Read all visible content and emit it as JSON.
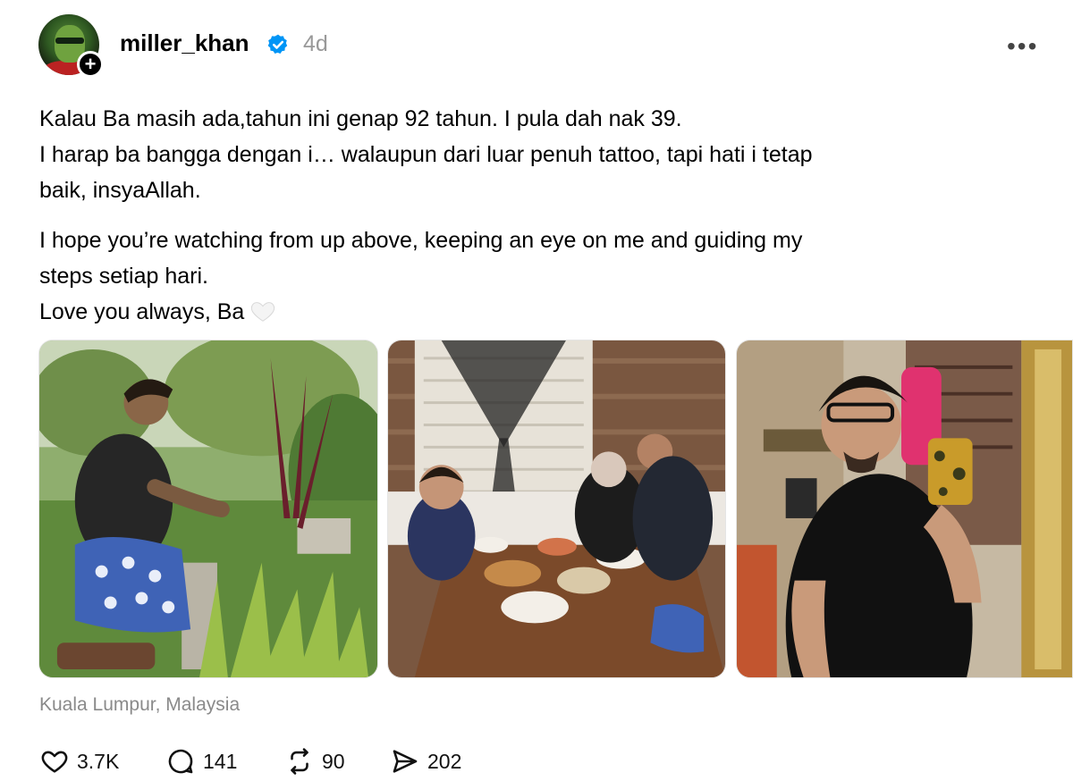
{
  "post": {
    "username": "miller_khan",
    "time_ago": "4d",
    "more_label": "•••",
    "caption": {
      "paragraph1_line1": "Kalau Ba masih ada,tahun ini genap 92 tahun. I pula dah nak 39.",
      "paragraph1_line2": "I harap ba bangga dengan i… walaupun dari luar penuh tattoo, tapi hati i tetap",
      "paragraph1_line3": "baik, insyaAllah.",
      "paragraph2_line1": "I hope you’re watching from up above, keeping an eye on me and guiding my",
      "paragraph2_line2": "steps setiap hari.",
      "paragraph2_line3": "Love you always, Ba"
    },
    "location": "Kuala Lumpur, Malaysia",
    "actions": {
      "likes": "3.7K",
      "comments": "141",
      "reposts": "90",
      "shares": "202"
    },
    "icons": {
      "verified": "verified-badge-icon",
      "like": "heart-icon",
      "comment": "comment-bubble-icon",
      "repost": "repost-icon",
      "share": "send-icon",
      "emoji": "white-heart-emoji"
    },
    "colors": {
      "verified_blue": "#0095f6",
      "muted_text": "#999999"
    }
  }
}
